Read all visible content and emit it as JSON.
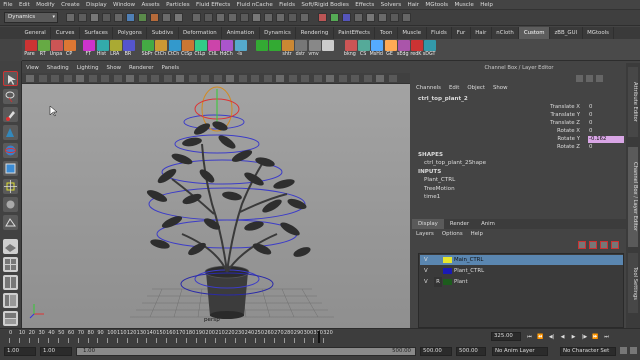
{
  "menubar": [
    "File",
    "Edit",
    "Modify",
    "Create",
    "Display",
    "Window",
    "Assets",
    "Particles",
    "Fluid Effects",
    "Fluid nCache",
    "Fields",
    "Soft/Rigid Bodies",
    "Effects",
    "Solvers",
    "Hair",
    "MGtools",
    "Muscle",
    "Help"
  ],
  "status": {
    "mode": "Dynamics"
  },
  "shelf_tabs": [
    "General",
    "Curves",
    "Surfaces",
    "Polygons",
    "Subdivs",
    "Deformation",
    "Animation",
    "Dynamics",
    "Rendering",
    "PaintEffects",
    "Toon",
    "Muscle",
    "Fluids",
    "Fur",
    "Hair",
    "nCloth",
    "Custom",
    "zBB_GUI",
    "MGtools"
  ],
  "shelf_active_tab": "Custom",
  "shelf_buttons": [
    "Pare",
    "RT",
    "Unpa",
    "CP",
    "FT",
    "Hist",
    "LRA",
    "BR",
    "SbPr",
    "CtCh",
    "CtCh",
    "CtSp",
    "CtLp",
    "CtlL",
    "HdCh",
    "-ls",
    "",
    "",
    "shtr",
    "dstr",
    "vmv",
    "",
    "bkng",
    "CS",
    "MsHd",
    "GE",
    "sEdg",
    "redK",
    "sDGT"
  ],
  "viewport_menu": [
    "View",
    "Shading",
    "Lighting",
    "Show",
    "Renderer",
    "Panels"
  ],
  "viewport_label": "persp",
  "channel_box": {
    "header": "Channel Box / Layer Editor",
    "menu": [
      "Channels",
      "Edit",
      "Object",
      "Show"
    ],
    "object_name": "ctrl_top_plant_2",
    "attributes": [
      {
        "name": "Translate X",
        "value": "0"
      },
      {
        "name": "Translate Y",
        "value": "0"
      },
      {
        "name": "Translate Z",
        "value": "0"
      },
      {
        "name": "Rotate X",
        "value": "0"
      },
      {
        "name": "Rotate Y",
        "value": "-0.162"
      },
      {
        "name": "Rotate Z",
        "value": "0"
      }
    ],
    "shapes_label": "SHAPES",
    "shape_name": "ctrl_top_plant_2Shape",
    "inputs_label": "INPUTS",
    "inputs": [
      "Plant_CTRL",
      "TreeMotion",
      "time1"
    ]
  },
  "layer_editor": {
    "tabs": [
      "Display",
      "Render",
      "Anim"
    ],
    "active_tab": "Display",
    "menu": [
      "Layers",
      "Options",
      "Help"
    ],
    "layers": [
      {
        "v": "V",
        "r": "",
        "name": "Main_CTRL",
        "color": "#e6e62e",
        "selected": true
      },
      {
        "v": "V",
        "r": "",
        "name": "Plant_CTRL",
        "color": "#1a1ab4",
        "selected": false
      },
      {
        "v": "V",
        "r": "R",
        "name": "Plant",
        "color": "#1d5c1d",
        "selected": false
      }
    ]
  },
  "side_tabs": [
    "Attribute Editor",
    "Channel Box / Layer Editor",
    "Tool Settings"
  ],
  "timeline": {
    "ticks": [
      "0",
      "10",
      "20",
      "30",
      "40",
      "50",
      "60",
      "70",
      "80",
      "90",
      "100",
      "110",
      "120",
      "130",
      "140",
      "150",
      "160",
      "170",
      "180",
      "190",
      "200",
      "210",
      "220",
      "230",
      "240",
      "250",
      "260",
      "270",
      "280",
      "290",
      "300",
      "310",
      "320"
    ],
    "current_frame": "325.00"
  },
  "range": {
    "start": "1.00",
    "playback_start": "1.00",
    "playback_end": "500.00",
    "end": "500.00",
    "anim_layer": "No Anim Layer",
    "character_set": "No Character Set"
  },
  "colors": {
    "selection_blue": "#5a86b0",
    "highlight_pink": "#d9a6e6"
  }
}
